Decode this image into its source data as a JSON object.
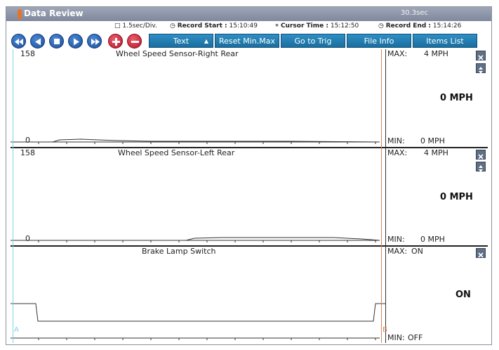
{
  "window": {
    "title": "Data Review",
    "duration": "30.3sec"
  },
  "info": {
    "div": "1.5sec/Div.",
    "record_start_label": "Record Start :",
    "record_start": "15:10:49",
    "cursor_time_label": "Cursor Time :",
    "cursor_time": "15:12:50",
    "record_end_label": "Record End :",
    "record_end": "15:14:26"
  },
  "toolbar": {
    "text_label": "Text",
    "reset_label": "Reset Min.Max",
    "trig_label": "Go to Trig",
    "fileinfo_label": "File Info",
    "items_label": "Items List"
  },
  "panels": [
    {
      "title": "Wheel Speed Sensor-Right Rear",
      "ymax": "158",
      "ymin": "0",
      "max_label": "MAX:",
      "max_value": "4 MPH",
      "current": "0 MPH",
      "min_label": "MIN:",
      "min_value": "0 MPH"
    },
    {
      "title": "Wheel Speed Sensor-Left Rear",
      "ymax": "158",
      "ymin": "0",
      "max_label": "MAX:",
      "max_value": "4 MPH",
      "current": "0 MPH",
      "min_label": "MIN:",
      "min_value": "0 MPH"
    },
    {
      "title": "Brake Lamp Switch",
      "max_label": "MAX:",
      "max_value": "ON",
      "current": "ON",
      "min_label": "MIN:",
      "min_value": "OFF"
    }
  ],
  "cursors": {
    "a": "A",
    "b": "B"
  },
  "colors": {
    "title_bar": "#8790a4",
    "toolbar_button": "#2280b4",
    "nav_button": "#2b63b0",
    "zoom_button": "#c8283c",
    "cursor_a": "#7fd4e8",
    "cursor_b": "#d4845a"
  }
}
